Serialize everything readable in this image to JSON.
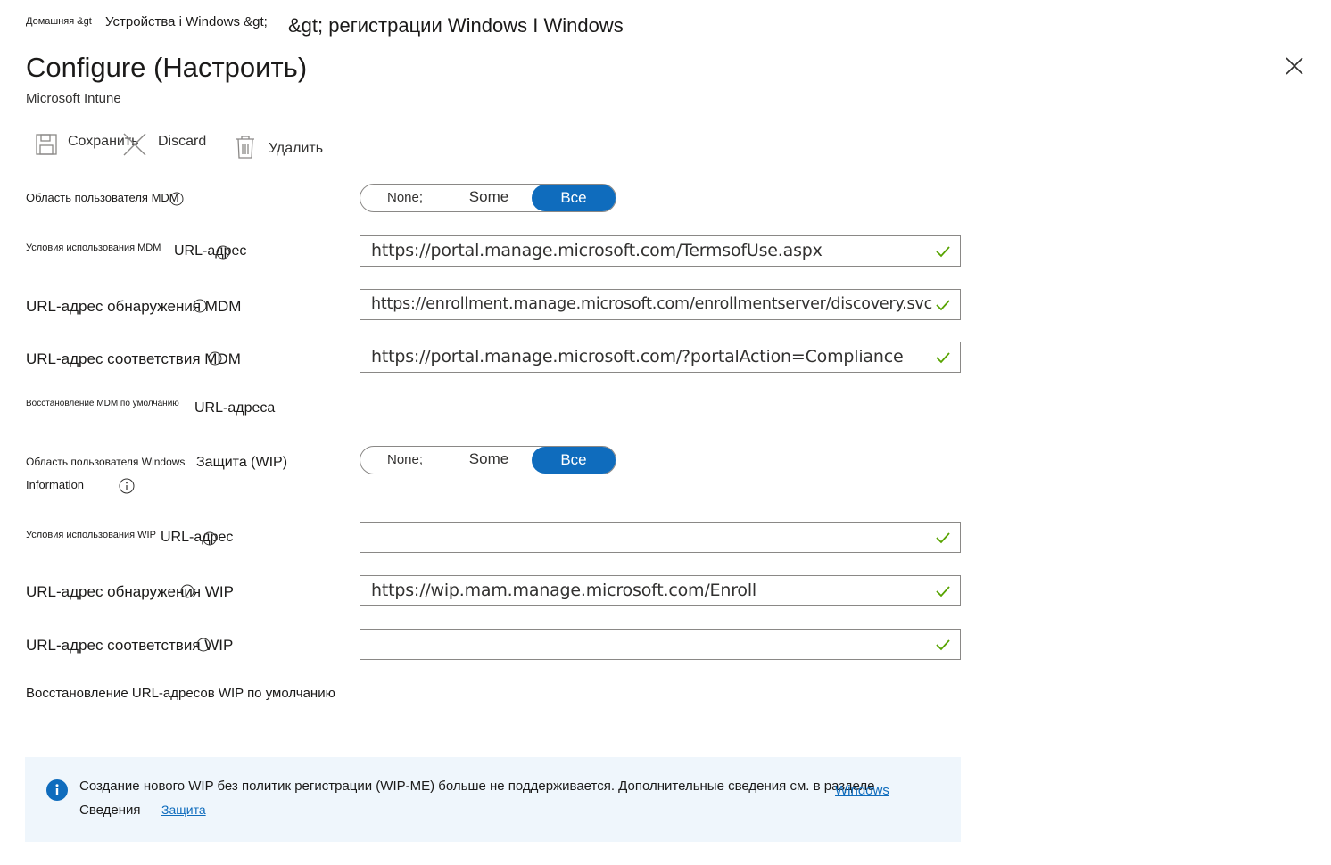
{
  "breadcrumb": {
    "home": "Домашняя &gt",
    "devices": "Устройства i Windows &gt;",
    "enrollment": "&gt; регистрации Windows I Windows"
  },
  "header": {
    "title": "Configure (Настроить)",
    "subtitle": "Microsoft Intune",
    "close_icon": "close-icon"
  },
  "toolbar": {
    "save_label": "Сохранить",
    "discard_label": "Discard",
    "delete_label": "Удалить"
  },
  "mdm": {
    "user_scope": {
      "label": "Область пользователя MDM",
      "options": [
        "None;",
        "Some",
        "Все"
      ],
      "selected": "Все"
    },
    "terms_url": {
      "label_small": "Условия использования MDM",
      "label_main": "URL-адрес",
      "value": "https://portal.manage.microsoft.com/TermsofUse.aspx"
    },
    "discovery_url": {
      "label": "URL-адрес обнаружения MDM",
      "value": "https://enrollment.manage.microsoft.com/enrollmentserver/discovery.svc"
    },
    "compliance_url": {
      "label": "URL-адрес соответствия MDM",
      "value": "https://portal.manage.microsoft.com/?portalAction=Compliance"
    },
    "restore": {
      "label_small": "Восстановление MDM по умолчанию",
      "label_main": "URL-адреса"
    }
  },
  "wip": {
    "user_scope": {
      "label_small": "Область пользователя Windows",
      "label_main": "Защита (WIP)",
      "label_line2": "Information",
      "options": [
        "None;",
        "Some",
        "Все"
      ],
      "selected": "Все"
    },
    "terms_url": {
      "label_small": "Условия использования WIP",
      "label_main": "URL-адрес",
      "value": ""
    },
    "discovery_url": {
      "label": "URL-адрес обнаружения WIP",
      "value": "https://wip.mam.manage.microsoft.com/Enroll"
    },
    "compliance_url": {
      "label": "URL-адрес соответствия WIP",
      "value": ""
    },
    "restore_label": "Восстановление URL-адресов WIP по умолчанию"
  },
  "banner": {
    "line1": "Создание нового WIP без политик регистрации (WIP-ME) больше не поддерживается. Дополнительные сведения см. в разделе",
    "link_windows": "Windows",
    "line2_prefix": "Сведения",
    "link_protection": "Защита"
  },
  "colors": {
    "accent": "#0f6cbd",
    "valid_check": "#57a300",
    "banner_bg": "#eff6fc"
  }
}
